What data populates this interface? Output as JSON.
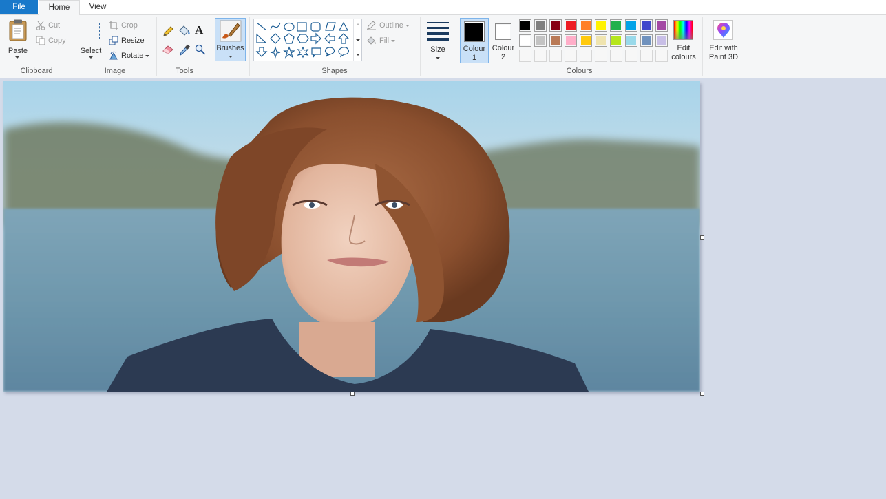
{
  "tabs": {
    "file": "File",
    "home": "Home",
    "view": "View"
  },
  "clipboard": {
    "paste": "Paste",
    "cut": "Cut",
    "copy": "Copy",
    "group": "Clipboard"
  },
  "image": {
    "select": "Select",
    "crop": "Crop",
    "resize": "Resize",
    "rotate": "Rotate",
    "group": "Image"
  },
  "tools": {
    "group": "Tools",
    "icons": [
      "pencil-icon",
      "fill-icon",
      "text-icon",
      "eraser-icon",
      "colour-picker-icon",
      "magnifier-icon"
    ]
  },
  "brushes": {
    "label": "Brushes"
  },
  "shapes": {
    "group": "Shapes",
    "outline": "Outline",
    "fill": "Fill"
  },
  "size": {
    "label": "Size"
  },
  "colours": {
    "colour1_label": [
      "Colour",
      "1"
    ],
    "colour2_label": [
      "Colour",
      "2"
    ],
    "colour1": "#000000",
    "colour2": "#ffffff",
    "edit_label": [
      "Edit",
      "colours"
    ],
    "group": "Colours",
    "palette_row1": [
      "#000000",
      "#7f7f7f",
      "#880015",
      "#ed1c24",
      "#ff7f27",
      "#fff200",
      "#22b14c",
      "#00a2e8",
      "#3f48cc",
      "#a349a4"
    ],
    "palette_row2": [
      "#ffffff",
      "#c3c3c3",
      "#b97a57",
      "#ffaec9",
      "#ffc90e",
      "#efe4b0",
      "#b5e61d",
      "#99d9ea",
      "#7092be",
      "#c8bfe7"
    ],
    "palette_row3": [
      "",
      "",
      "",
      "",
      "",
      "",
      "",
      "",
      "",
      ""
    ]
  },
  "paint3d": {
    "label": [
      "Edit with",
      "Paint 3D"
    ]
  },
  "accent": "#1979ca"
}
